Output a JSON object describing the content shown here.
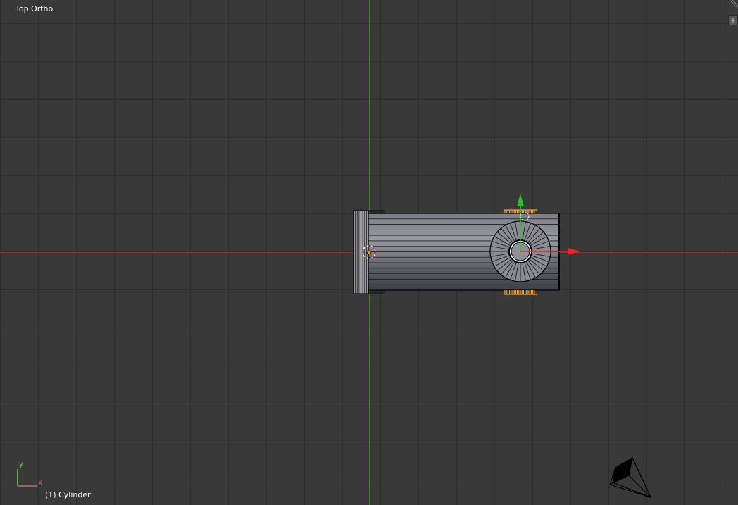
{
  "viewport": {
    "view_label": "Top Ortho",
    "object_info": "(1) Cylinder",
    "corner_button_glyph": "+",
    "mini_axis_y": "y",
    "mini_axis_x": "x"
  },
  "colors": {
    "background": "#393939",
    "grid": "#2f2f2f",
    "axis_x": "#7a3a3a",
    "axis_y": "#4c7a2c",
    "gizmo_x": "#e02a2a",
    "gizmo_y": "#2fbf2f",
    "selection": "#f0a030",
    "mesh_fill": "#6e6e78",
    "mesh_wire": "#000000"
  },
  "icons": {
    "camera": "camera-object-icon",
    "origin": "object-origin-icon",
    "cursor": "3d-cursor-icon",
    "corner": "area-split-icon"
  }
}
